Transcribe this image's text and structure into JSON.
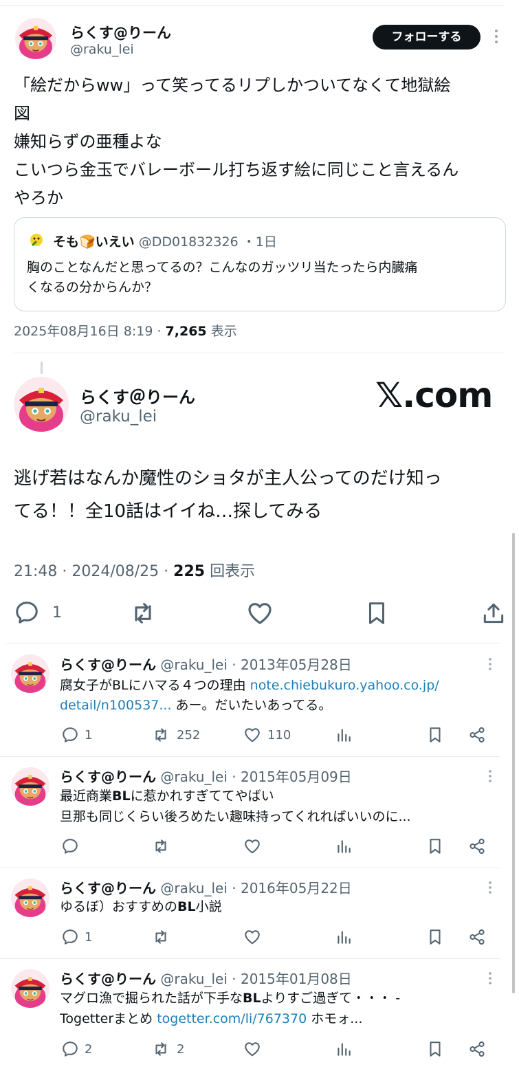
{
  "top": {
    "display_name": "らくす@りーん",
    "handle": "@raku_lei",
    "follow_label": "フォローする",
    "text_lines": [
      "「絵だからww」って笑ってるリプしかついてなくて地獄絵",
      "図",
      "嫌知らずの亜種よな",
      "こいつら金玉でバレーボール打ち返す絵に同じこと言えるん",
      "やろか"
    ],
    "quote": {
      "name": "そも🍞いえい",
      "handle": "@DD01832326",
      "time": "・1日",
      "text_lines": [
        "胸のことなんだと思ってるの？こんなのガッツリ当たったら内臓痛",
        "くなるの分からんか？"
      ]
    },
    "meta_date": "2025年08月16日 8:19 · ",
    "views_count": "7,265",
    "views_label": " 表示"
  },
  "middle": {
    "display_name": "らくす＠りーん",
    "handle": "@raku_lei",
    "brand": "𝕏.com",
    "text_lines": [
      "逃げ若はなんか魔性のショタが主人公ってのだけ知っ",
      "てる！！全10話はイイね…探してみる"
    ],
    "meta_time": "21:48 · 2024/08/25 · ",
    "views_count": "225",
    "views_label": " 回表示",
    "reply_count": "1"
  },
  "tweets": [
    {
      "name": "らくす@りーん",
      "handle": "@raku_lei",
      "date": "· 2013年05月28日",
      "line1_pre": "腐女子がBLにハマる４つの理由 ",
      "line1_link": "note.chiebukuro.yahoo.co.jp/",
      "line2_link": "detail/n100537...",
      "line2_post": " あー。だいたいあってる。",
      "replies": "1",
      "retweets": "252",
      "likes": "110"
    },
    {
      "name": "らくす@りーん",
      "handle": "@raku_lei",
      "date": "· 2015年05月09日",
      "line1_a": "最近商業",
      "line1_b": "BL",
      "line1_c": "に惹かれすぎててやばい",
      "line2": "旦那も同じくらい後ろめたい趣味持ってくれればいいのに..."
    },
    {
      "name": "らくす@りーん",
      "handle": "@raku_lei",
      "date": "· 2016年05月22日",
      "line1_a": "ゆるぼ）おすすめの",
      "line1_b": "BL",
      "line1_c": "小説",
      "replies": "1"
    },
    {
      "name": "らくす@りーん",
      "handle": "@raku_lei",
      "date": "· 2015年01月08日",
      "line1_a": "マグロ漁で掘られた話が下手な",
      "line1_b": "BL",
      "line1_c": "よりすご過ぎて・・・ -",
      "line2_pre": "Togetterまとめ ",
      "line2_link": "togetter.com/li/767370",
      "line2_post": " ホモォ...",
      "replies": "2",
      "retweets": "2"
    }
  ],
  "colors": {
    "text": "#0f1419",
    "muted": "#536471",
    "link": "#1d7fb8",
    "follow_bg": "#0f1419"
  }
}
